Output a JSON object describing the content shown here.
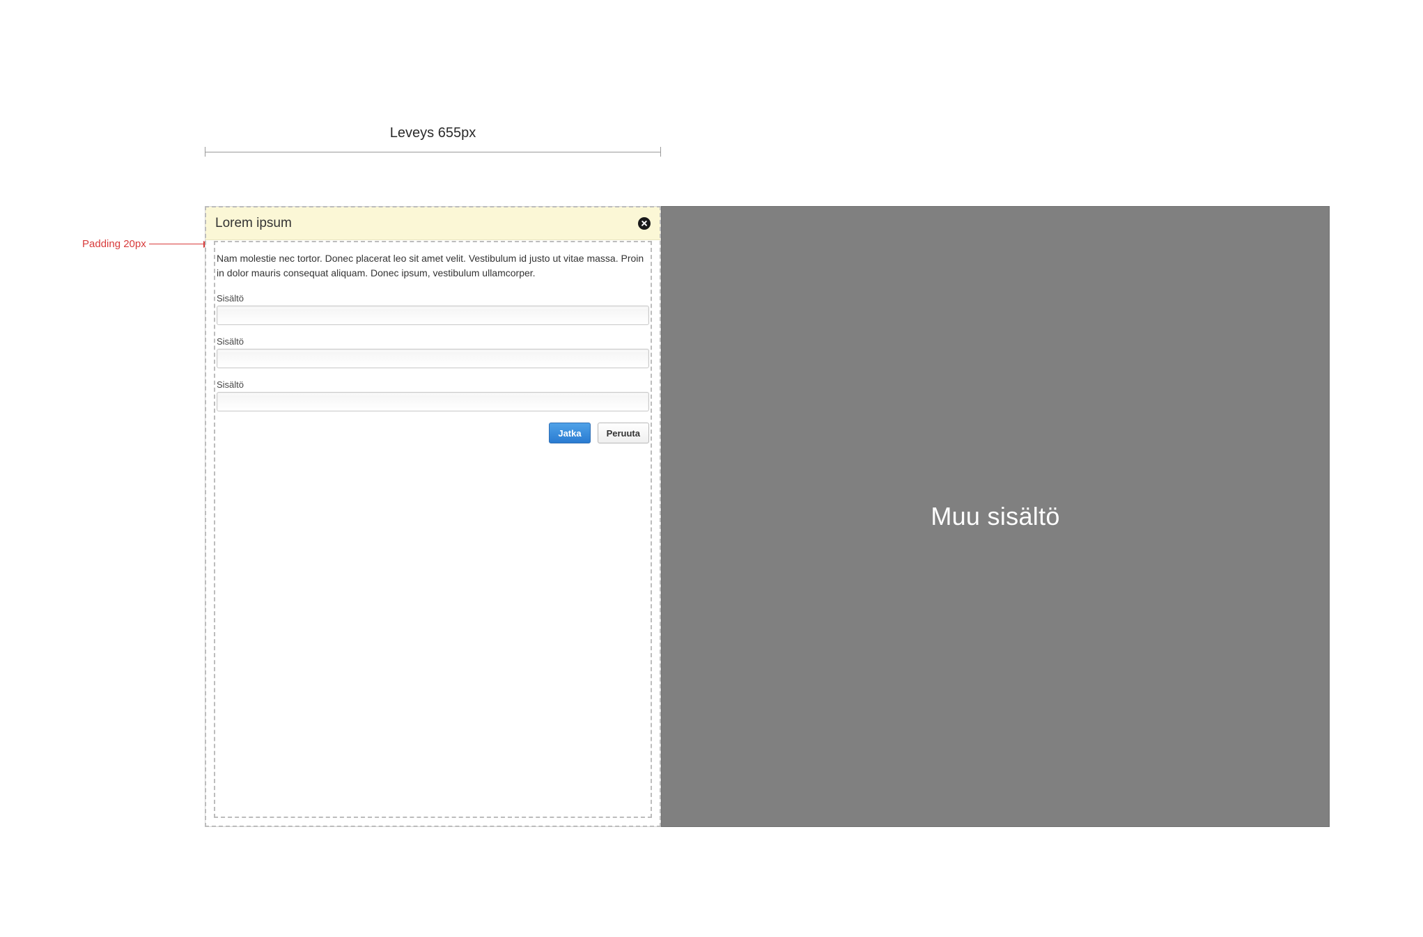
{
  "dimensions": {
    "width_label": "Leveys 655px"
  },
  "annotations": {
    "padding_label": "Padding 20px"
  },
  "panel": {
    "title": "Lorem ipsum",
    "intro": "Nam molestie nec tortor. Donec placerat leo sit amet velit. Vestibulum id justo ut vitae massa. Proin in dolor mauris consequat aliquam. Donec ipsum, vestibulum ullamcorper.",
    "fields": [
      {
        "label": "Sisältö",
        "value": ""
      },
      {
        "label": "Sisältö",
        "value": ""
      },
      {
        "label": "Sisältö",
        "value": ""
      }
    ],
    "buttons": {
      "primary": "Jatka",
      "secondary": "Peruuta"
    }
  },
  "right": {
    "label": "Muu sisältö"
  }
}
